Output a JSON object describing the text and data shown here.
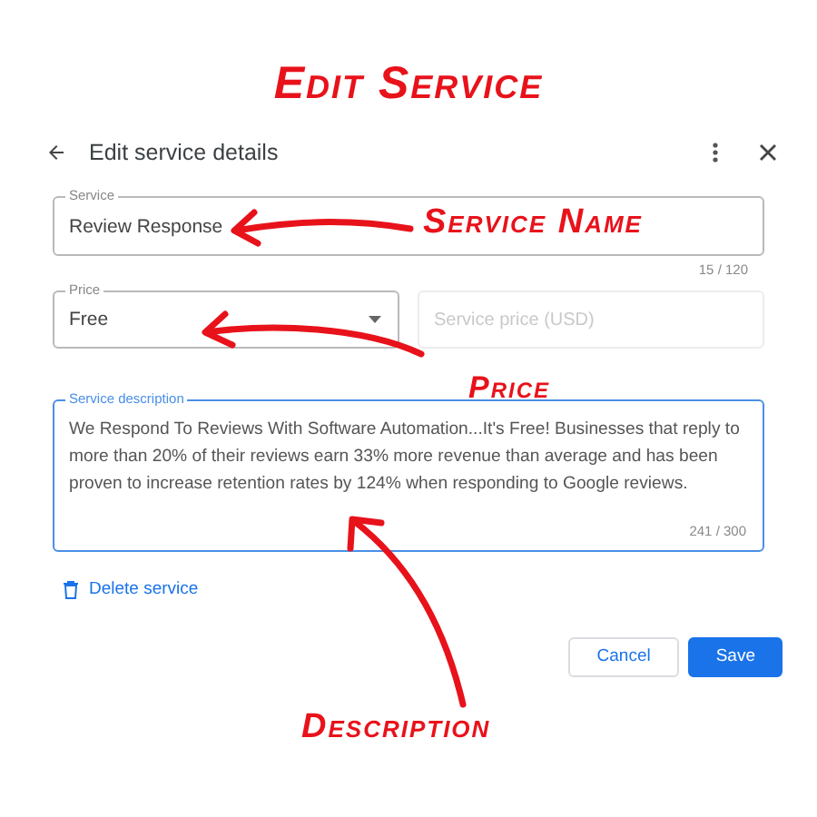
{
  "heading": "Edit Service",
  "dialog": {
    "title": "Edit service details",
    "service": {
      "label": "Service",
      "value": "Review Response",
      "counter": "15 / 120"
    },
    "price": {
      "label": "Price",
      "value": "Free"
    },
    "service_price": {
      "placeholder": "Service price (USD)",
      "disabled": true
    },
    "description": {
      "label": "Service description",
      "value": "We Respond To Reviews With Software Automation...It's Free! Businesses that reply to more than 20% of their reviews earn 33% more revenue than average and has been proven to increase retention rates by 124% when responding to Google reviews.",
      "counter": "241 / 300",
      "focused": true
    },
    "delete_link": "Delete service",
    "buttons": [
      {
        "label": "Cancel",
        "kind": "secondary"
      },
      {
        "label": "Save",
        "kind": "primary"
      }
    ]
  },
  "annotations": [
    {
      "label": "Service Name"
    },
    {
      "label": "Price"
    },
    {
      "label": "Description"
    }
  ]
}
